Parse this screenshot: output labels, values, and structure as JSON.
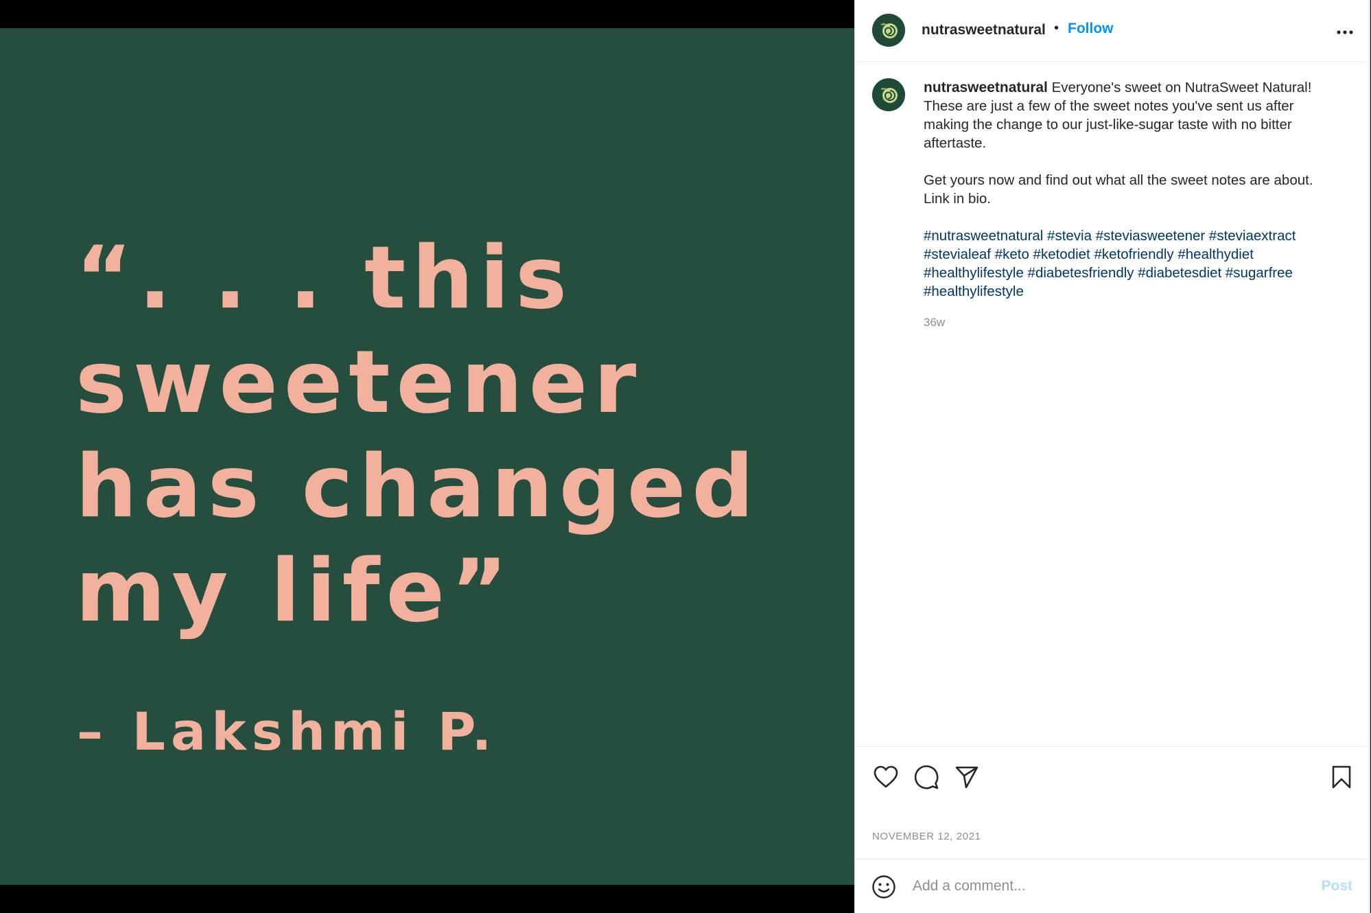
{
  "media": {
    "background_color": "#264e3f",
    "text_color": "#f2b19d",
    "quote": "“. . . this\nsweetener\nhas changed\nmy life”",
    "attribution": "– Lakshmi P."
  },
  "header": {
    "username": "nutrasweetnatural",
    "separator": "•",
    "follow_label": "Follow",
    "more_icon": "more-horizontal-icon"
  },
  "caption": {
    "username": "nutrasweetnatural",
    "text": "Everyone's sweet on NutraSweet Natural! These are just a few of the sweet notes you've sent us after making the change to our just-like-sugar taste with no bitter aftertaste.",
    "paragraph2": "Get yours now and find out what all the sweet notes are about. Link in bio.",
    "hashtags": "#nutrasweetnatural #stevia #steviasweetener #steviaextract #stevialeaf #keto #ketodiet #ketofriendly #healthydiet #healthylifestyle #diabetesfriendly #diabetesdiet #sugarfree #healthylifestyle",
    "age": "36w"
  },
  "actions": {
    "like_icon": "heart-icon",
    "comment_icon": "comment-icon",
    "share_icon": "send-icon",
    "save_icon": "bookmark-icon"
  },
  "post_date": "NOVEMBER 12, 2021",
  "comment": {
    "emoji_icon": "emoji-icon",
    "placeholder": "Add a comment...",
    "post_label": "Post"
  },
  "colors": {
    "follow": "#0095f6",
    "hashtag": "#00376b",
    "post_disabled": "#b2dffc"
  }
}
